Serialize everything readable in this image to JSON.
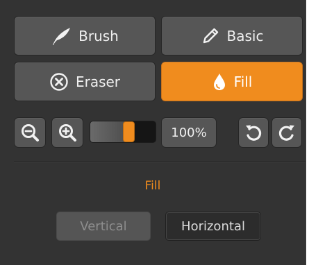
{
  "tools": {
    "brush_label": "Brush",
    "basic_label": "Basic",
    "eraser_label": "Eraser",
    "fill_label": "Fill",
    "active_tool": "fill"
  },
  "zoom": {
    "level_label": "100%",
    "slider_level": 0.6
  },
  "fill_section": {
    "title": "Fill",
    "vertical_label": "Vertical",
    "horizontal_label": "Horizontal",
    "selected": "horizontal"
  },
  "icons": {
    "brush": "feather-brush-icon",
    "basic": "pencil-icon",
    "eraser": "circle-x-icon",
    "fill": "droplet-icon",
    "zoom_out": "zoom-out-icon",
    "zoom_in": "zoom-in-icon",
    "undo": "undo-icon",
    "redo": "redo-icon"
  },
  "colors": {
    "accent": "#f08c1e",
    "panel_bg": "#333333",
    "button_bg": "#565656",
    "text": "#f0f0f0"
  }
}
